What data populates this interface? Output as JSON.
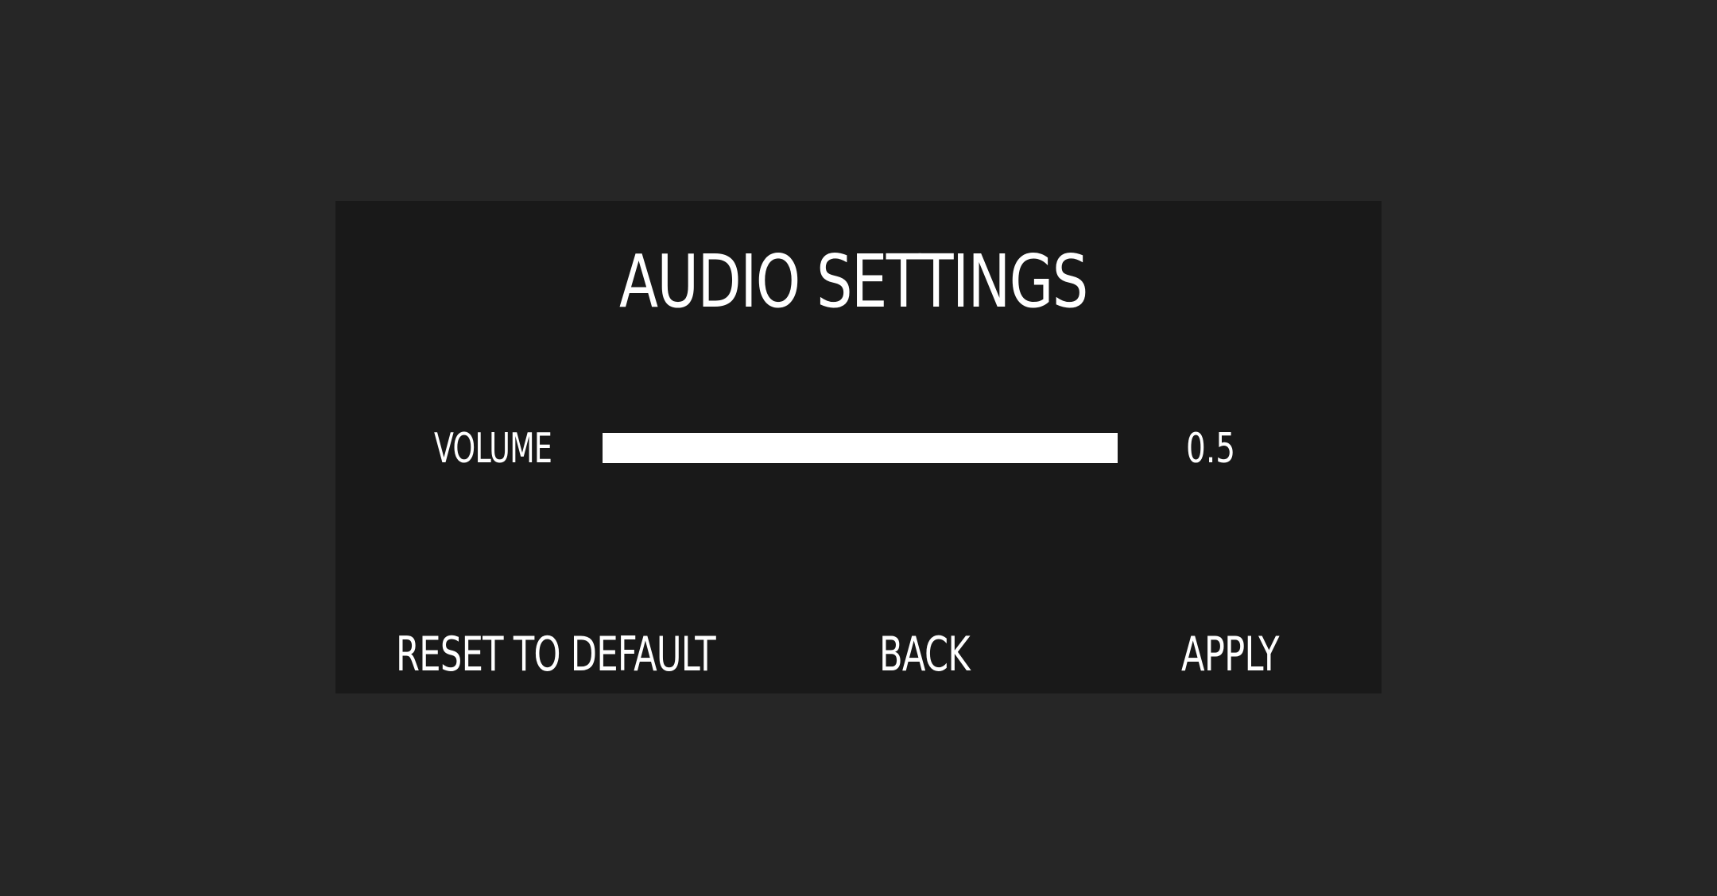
{
  "screen": {
    "title": "AUDIO SETTINGS"
  },
  "volume": {
    "label": "VOLUME",
    "value_text": "0.5",
    "value": 0.5,
    "slider_fill_fraction": 1.0
  },
  "buttons": {
    "reset_label": "RESET TO DEFAULT",
    "back_label": "BACK",
    "apply_label": "APPLY"
  },
  "colors": {
    "background": "#262626",
    "panel": "#191919",
    "text": "#ffffff",
    "slider_fill": "#ffffff"
  }
}
